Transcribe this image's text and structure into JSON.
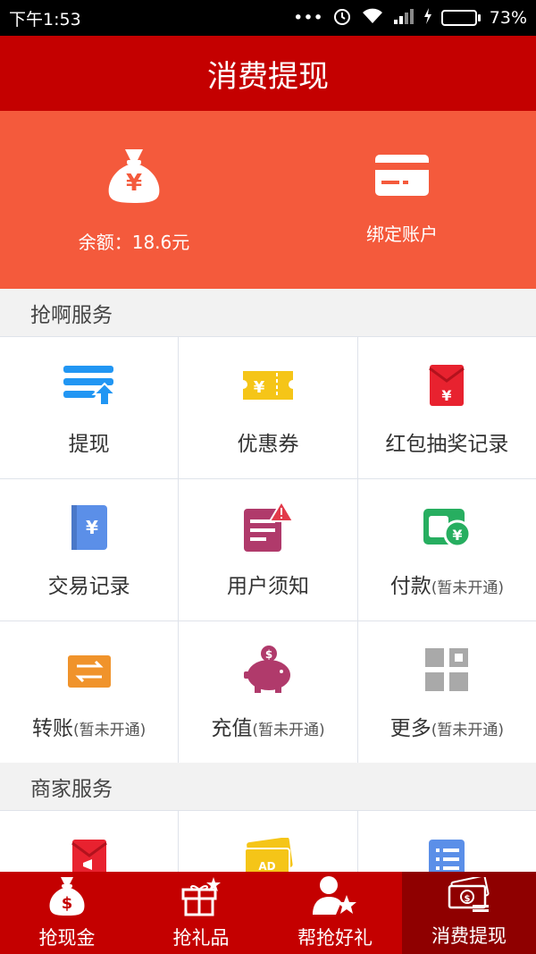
{
  "status_bar": {
    "time": "下午1:53",
    "battery": "73%",
    "battery_level": 0.73
  },
  "header": {
    "title": "消费提现"
  },
  "hero": {
    "balance_label": "余额：18.6元",
    "bind_label": "绑定账户"
  },
  "sections": [
    {
      "title": "抢啊服务",
      "items": [
        {
          "label": "提现",
          "note": "",
          "icon": "withdraw-icon"
        },
        {
          "label": "优惠券",
          "note": "",
          "icon": "coupon-icon"
        },
        {
          "label": "红包抽奖记录",
          "note": "",
          "icon": "red-packet-icon"
        },
        {
          "label": "交易记录",
          "note": "",
          "icon": "ledger-icon"
        },
        {
          "label": "用户须知",
          "note": "",
          "icon": "notice-icon"
        },
        {
          "label": "付款",
          "note": "(暂未开通)",
          "icon": "wallet-icon"
        },
        {
          "label": "转账",
          "note": "(暂未开通)",
          "icon": "transfer-icon"
        },
        {
          "label": "充值",
          "note": "(暂未开通)",
          "icon": "piggy-bank-icon"
        },
        {
          "label": "更多",
          "note": "(暂未开通)",
          "icon": "more-grid-icon"
        }
      ]
    },
    {
      "title": "商家服务",
      "items": [
        {
          "icon": "promo-packet-icon"
        },
        {
          "icon": "ad-ticket-icon"
        },
        {
          "icon": "list-icon"
        }
      ]
    }
  ],
  "tabbar": [
    {
      "label": "抢现金",
      "icon": "money-bag-icon",
      "active": false
    },
    {
      "label": "抢礼品",
      "icon": "gift-icon",
      "active": false
    },
    {
      "label": "帮抢好礼",
      "icon": "user-star-icon",
      "active": false
    },
    {
      "label": "消费提现",
      "icon": "cash-stack-icon",
      "active": true
    }
  ],
  "colors": {
    "header": "#c40000",
    "hero": "#f45a3c",
    "tab_active": "#8f0000"
  }
}
